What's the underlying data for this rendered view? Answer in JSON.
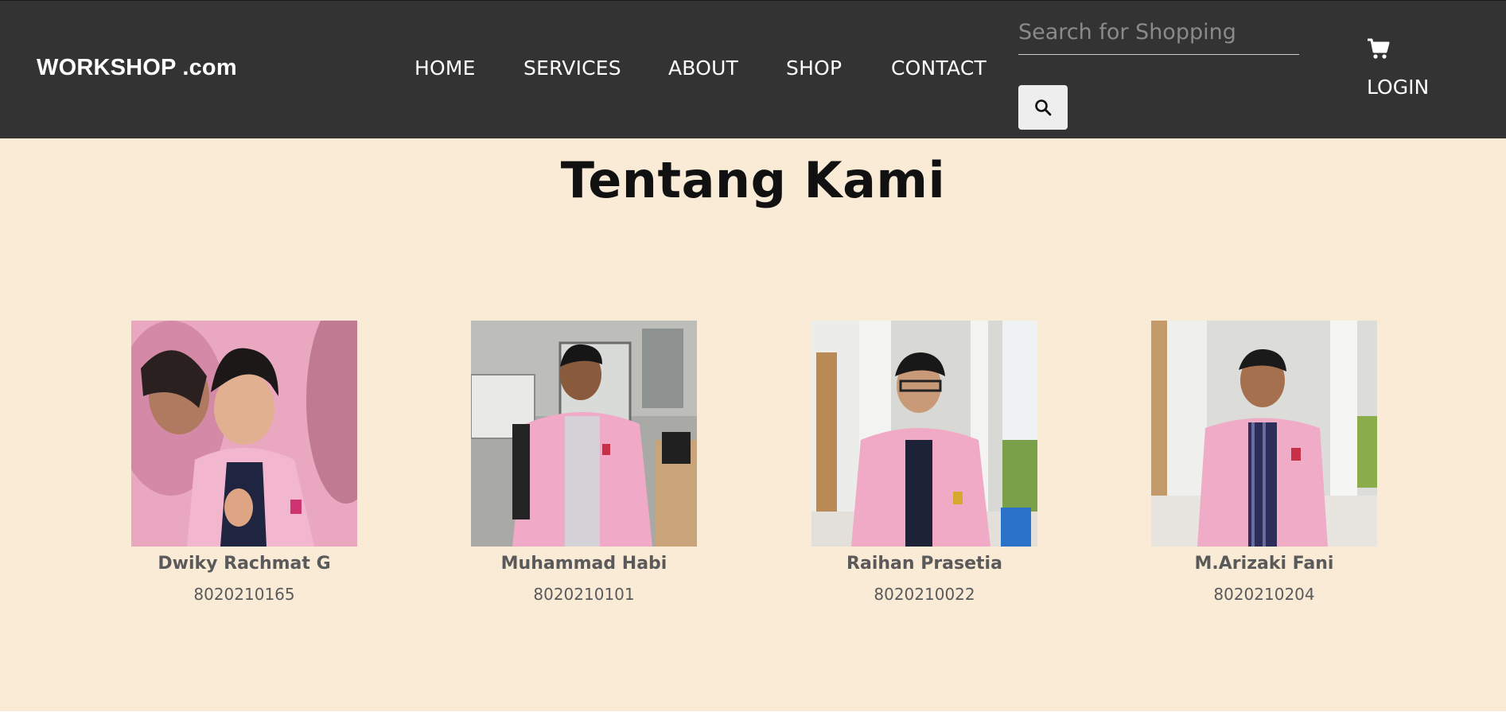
{
  "header": {
    "brand": "WORKSHOP .com",
    "nav": [
      {
        "label": "HOME"
      },
      {
        "label": "SERVICES"
      },
      {
        "label": "ABOUT"
      },
      {
        "label": "SHOP"
      },
      {
        "label": "CONTACT"
      }
    ],
    "search": {
      "placeholder": "Search for Shopping",
      "value": "",
      "button_icon": "search-icon"
    },
    "cart_icon": "cart-icon",
    "login_label": "LOGIN",
    "colors": {
      "background": "#333333",
      "text": "#ffffff"
    }
  },
  "main": {
    "title": "Tentang Kami",
    "background": "#faebd7",
    "members": [
      {
        "name": "Dwiky Rachmat G",
        "id": "8020210165",
        "photo": "member-photo"
      },
      {
        "name": "Muhammad Habi",
        "id": "8020210101",
        "photo": "member-photo"
      },
      {
        "name": "Raihan Prasetia",
        "id": "8020210022",
        "photo": "member-photo"
      },
      {
        "name": "M.Arizaki Fani",
        "id": "8020210204",
        "photo": "member-photo"
      }
    ]
  }
}
